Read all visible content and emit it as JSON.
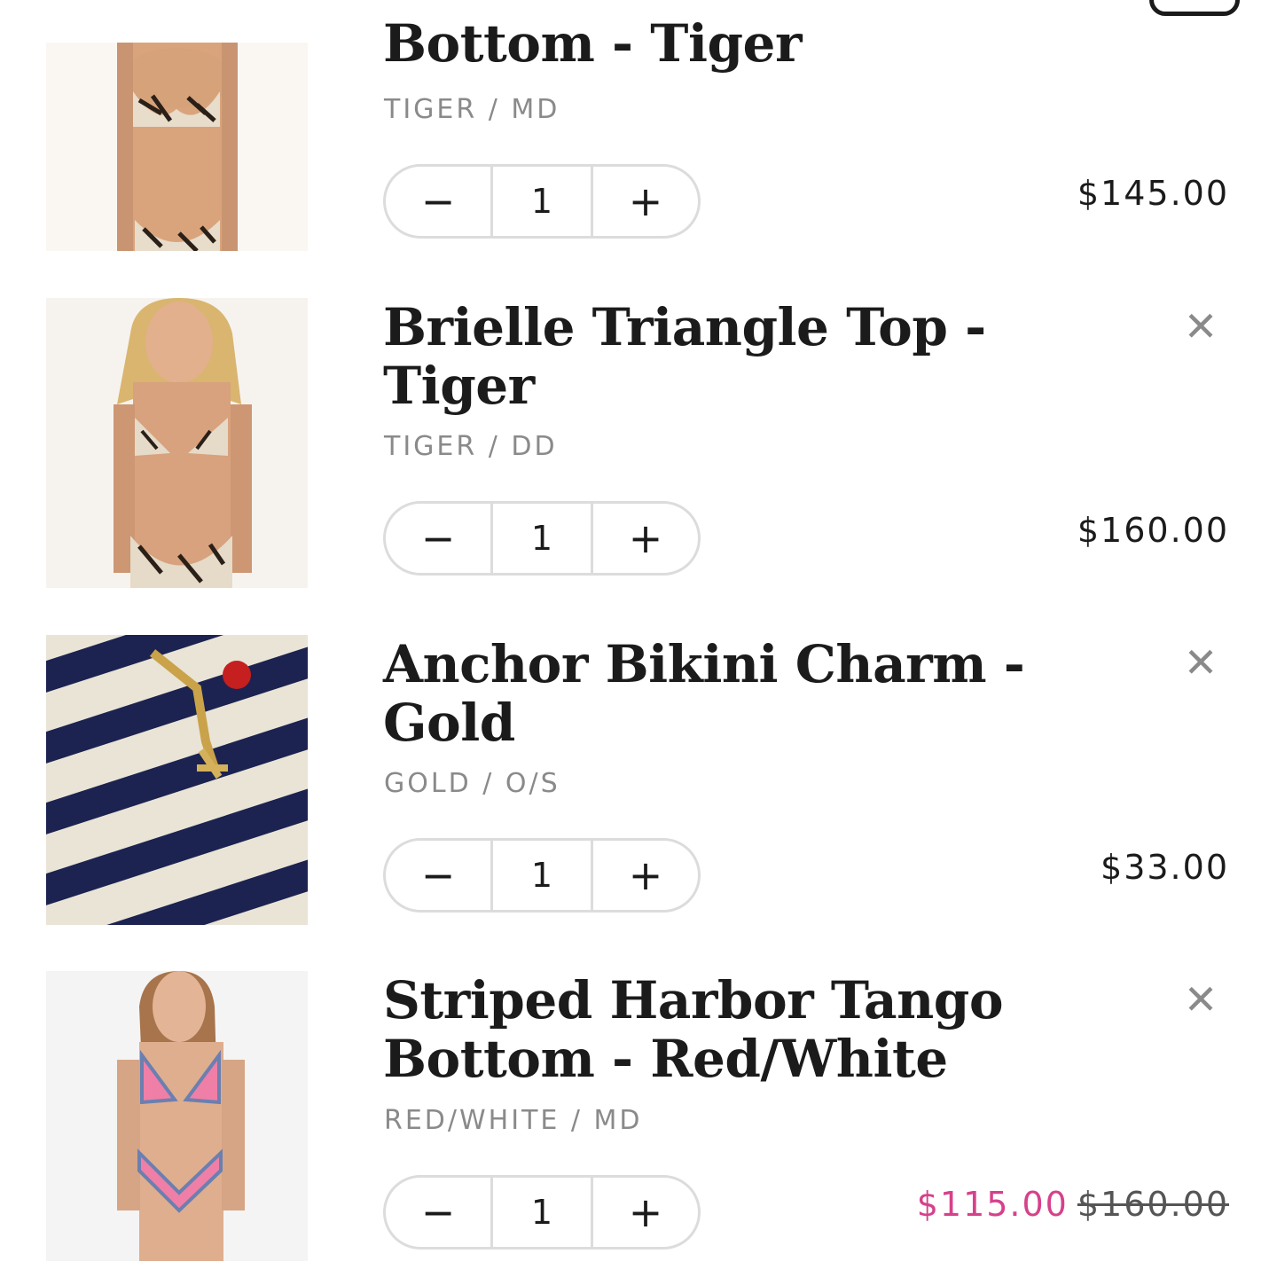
{
  "items": [
    {
      "title": "Bottom - Tiger",
      "variant": "TIGER / MD",
      "quantity": "1",
      "price": "$145.00",
      "image": "model wearing tiger print bikini"
    },
    {
      "title": "Brielle Triangle Top - Tiger",
      "variant": "TIGER / DD",
      "quantity": "1",
      "price": "$160.00",
      "image": "model wearing tiger print triangle top"
    },
    {
      "title": "Anchor Bikini Charm - Gold",
      "variant": "GOLD / O/S",
      "quantity": "1",
      "price": "$33.00",
      "image": "gold anchor charm on navy striped fabric"
    },
    {
      "title": "Striped Harbor Tango Bottom - Red/White",
      "variant": "RED/WHITE / MD",
      "quantity": "1",
      "sale_price": "$115.00",
      "original_price": "$160.00",
      "image": "model wearing pink striped bikini"
    }
  ],
  "controls": {
    "minus": "−",
    "plus": "+",
    "remove": "✕"
  },
  "colors": {
    "text": "#1b1b1b",
    "muted": "#8a8a8a",
    "border": "#dcdcdc",
    "sale": "#d6418b"
  }
}
